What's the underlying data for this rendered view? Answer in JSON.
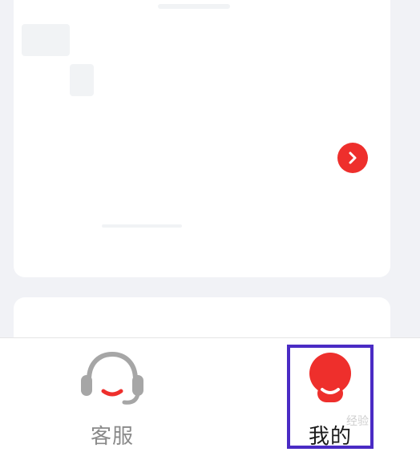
{
  "colors": {
    "accent": "#ee2f2c",
    "inactive_text": "#8a8a8a",
    "active_text": "#1a1a1a",
    "highlight_box": "#4a2bc4",
    "background": "#f1f2f6"
  },
  "main": {
    "card_arrow_icon": "chevron-right-icon"
  },
  "tabbar": {
    "tabs": [
      {
        "label": "客服",
        "icon": "headset-icon",
        "active": false
      },
      {
        "label": "我的",
        "icon": "user-icon",
        "active": true
      }
    ]
  },
  "watermark": {
    "text": "经验"
  }
}
